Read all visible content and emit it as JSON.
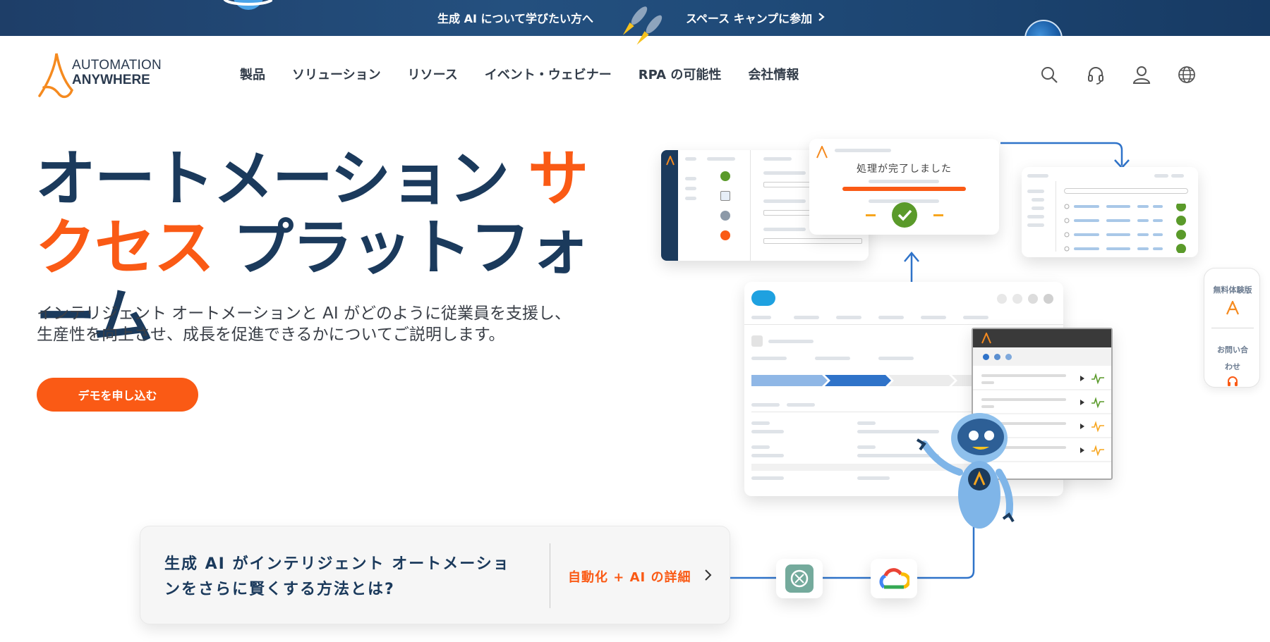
{
  "promo": {
    "left_text": "生成 AI について学びたい方へ",
    "right_text": "スペース キャンプに参加"
  },
  "logo": {
    "line1": "AUTOMATION",
    "line2": "ANYWHERE"
  },
  "nav": {
    "items": [
      "製品",
      "ソリューション",
      "リソース",
      "イベント・ウェビナー",
      "RPA の可能性",
      "会社情報"
    ]
  },
  "utility_icons": [
    "search-icon",
    "headset-icon",
    "user-icon",
    "globe-icon"
  ],
  "hero": {
    "title_part1": "オートメーション ",
    "title_accent": "サクセス",
    "title_part2": " プラットフォーム",
    "subtitle": "インテリジェント オートメーションと AI がどのように従業員を支援し、生産性を向上させ、成長を促進できるかについてご説明します。",
    "cta_label": "デモを申し込む"
  },
  "info_card": {
    "text": "生成 AI がインテリジェント オートメーションをさらに賢くする方法とは?",
    "link_label": "自動化 + AI の詳細"
  },
  "illustration": {
    "status_text": "処理が完了しました"
  },
  "side_widget": {
    "trial_label": "無料体験版",
    "contact_label": "お問い合わせ"
  },
  "colors": {
    "brand_orange": "#fa5a15",
    "navy": "#1b3a5c",
    "banner_blue": "#1e4a78",
    "diagram_blue": "#2f73c9",
    "check_green": "#5a9a2a"
  }
}
